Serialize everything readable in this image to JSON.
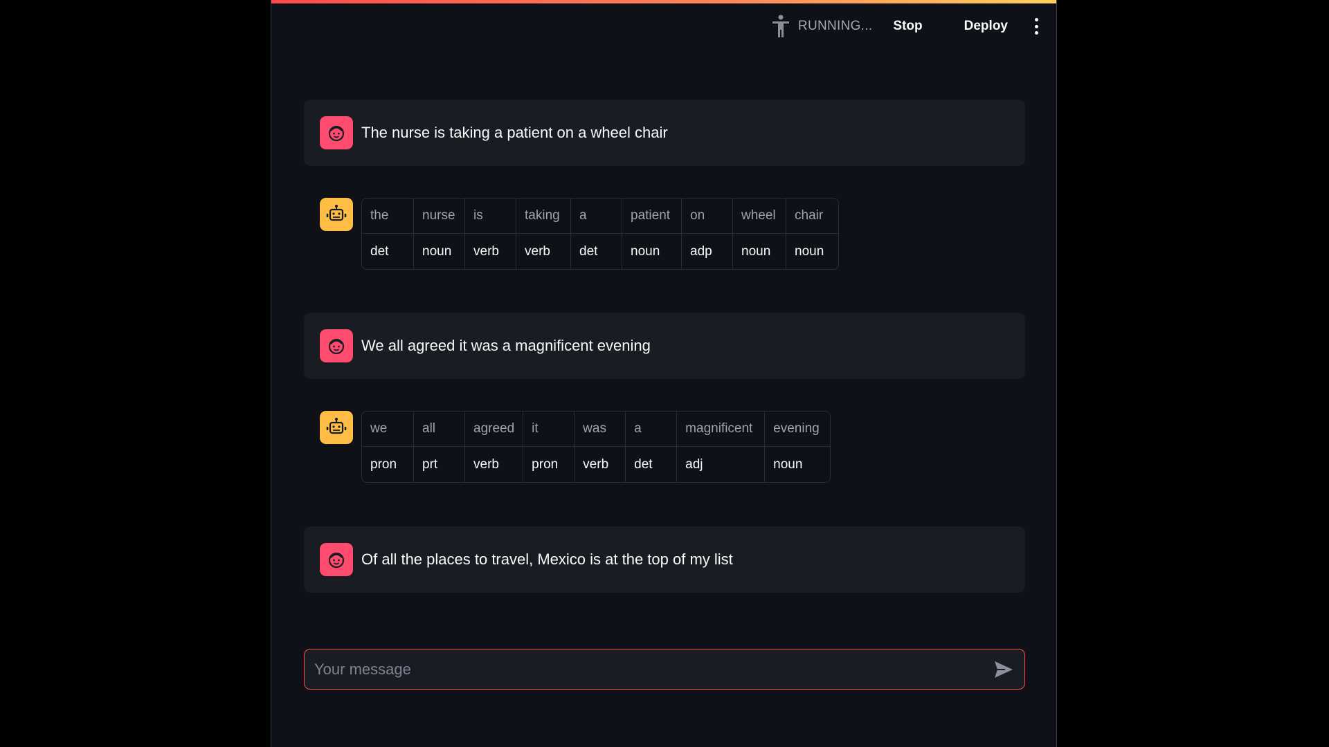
{
  "header": {
    "status_text": "RUNNING...",
    "stop_label": "Stop",
    "deploy_label": "Deploy",
    "status_icon": "running-person-icon",
    "menu_icon": "kebab-menu-icon"
  },
  "colors": {
    "background": "#0e1117",
    "user_avatar": "#ff4b6e",
    "assistant_avatar": "#ffbd45",
    "input_border": "#ff4b4b"
  },
  "messages": [
    {
      "role": "user",
      "text": "The nurse is taking a patient on a wheel chair"
    },
    {
      "role": "assistant",
      "words": [
        "the",
        "nurse",
        "is",
        "taking",
        "a",
        "patient",
        "on",
        "wheel",
        "chair"
      ],
      "tags": [
        "det",
        "noun",
        "verb",
        "verb",
        "det",
        "noun",
        "adp",
        "noun",
        "noun"
      ]
    },
    {
      "role": "user",
      "text": "We all agreed it was a magnificent evening"
    },
    {
      "role": "assistant",
      "words": [
        "we",
        "all",
        "agreed",
        "it",
        "was",
        "a",
        "magnificent",
        "evening"
      ],
      "tags": [
        "pron",
        "prt",
        "verb",
        "pron",
        "verb",
        "det",
        "adj",
        "noun"
      ]
    },
    {
      "role": "user",
      "text": "Of all the places to travel, Mexico is at the top of my list"
    }
  ],
  "chat_input": {
    "placeholder": "Your message",
    "value": ""
  }
}
